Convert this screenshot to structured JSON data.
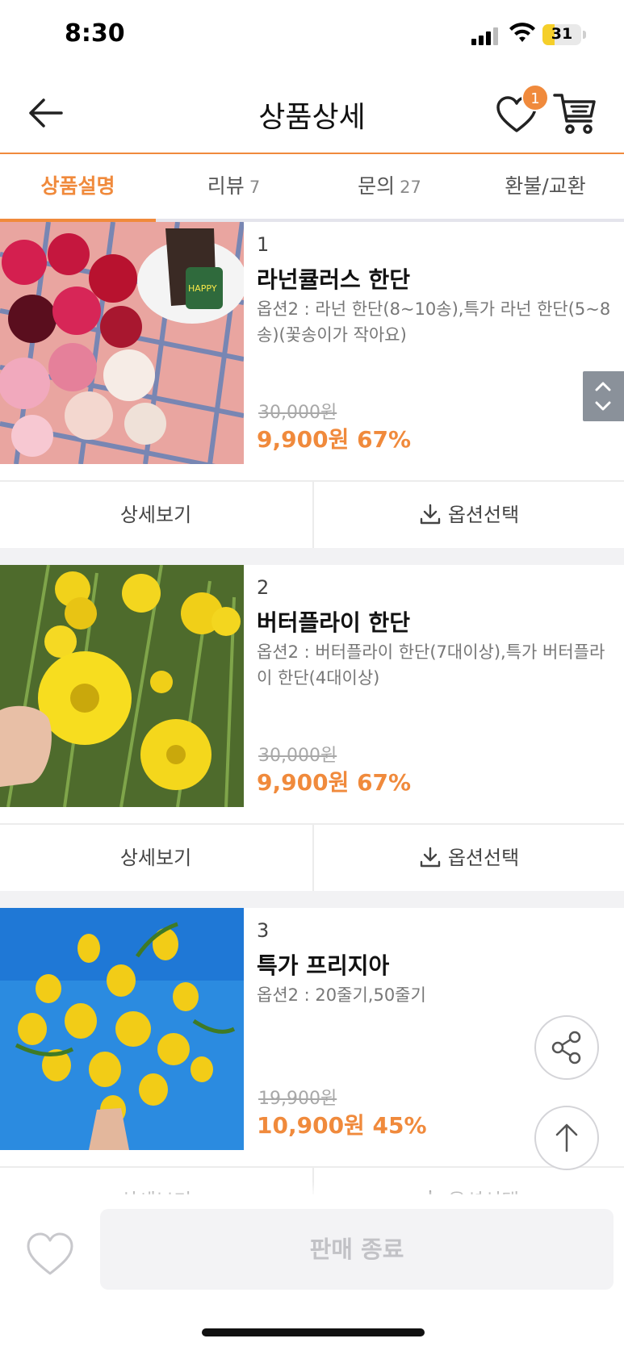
{
  "status": {
    "time": "8:30",
    "battery": "31",
    "battery_level_percent": 31
  },
  "header": {
    "title": "상품상세",
    "wish_count": "1"
  },
  "tabs": [
    {
      "label": "상품설명",
      "count": ""
    },
    {
      "label": "리뷰",
      "count": "7"
    },
    {
      "label": "문의",
      "count": "27"
    },
    {
      "label": "환불/교환",
      "count": ""
    }
  ],
  "products": [
    {
      "rank": "1",
      "name": "라넌큘러스 한단",
      "option": "옵션2 : 라넌 한단(8~10송),특가 라넌 한단(5~8송)(꽃송이가 작아요)",
      "original_price": "30,000원",
      "sale_price": "9,900원 67%",
      "detail_label": "상세보기",
      "option_label": "옵션선택"
    },
    {
      "rank": "2",
      "name": "버터플라이 한단",
      "option": "옵션2 : 버터플라이 한단(7대이상),특가 버터플라이 한단(4대이상)",
      "original_price": "30,000원",
      "sale_price": "9,900원 67%",
      "detail_label": "상세보기",
      "option_label": "옵션선택"
    },
    {
      "rank": "3",
      "name": "특가 프리지아",
      "option": "옵션2 : 20줄기,50줄기",
      "original_price": "19,900원",
      "sale_price": "10,900원 45%",
      "detail_label": "상세보기",
      "option_label": "옵션선택"
    }
  ],
  "bottom": {
    "soldout_label": "판매 종료"
  },
  "colors": {
    "accent": "#f08a3c",
    "muted": "#c2c2c6"
  }
}
